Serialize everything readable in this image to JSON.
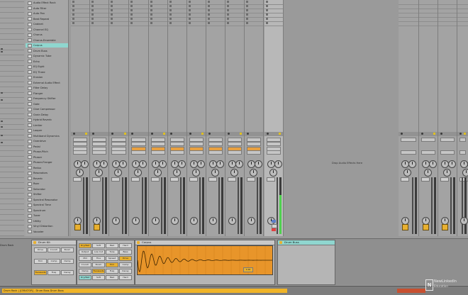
{
  "browser": {
    "items": [
      "Audio Effect Rack",
      "Auto Filter",
      "Auto Pan",
      "Beat Repeat",
      "Cabinet",
      "Channel EQ",
      "Chorus",
      "Chorus-Ensemble",
      "Corpus",
      "Drum Buss",
      "Dynamic Tube",
      "Echo",
      "EQ Eight",
      "EQ Three",
      "Erosion",
      "External Audio Effect",
      "Filter Delay",
      "Flanger",
      "Frequency Shifter",
      "Gate",
      "Glue Compressor",
      "Grain Delay",
      "Hybrid Reverb",
      "Limiter",
      "Looper",
      "Multiband Dynamics",
      "Overdrive",
      "Pedal",
      "Phase-Pitch",
      "Phaser",
      "Phaser-Flanger",
      "Redux",
      "Resonators",
      "Reverb",
      "Roar",
      "Saturator",
      "Shifter",
      "Spectral Resonator",
      "Spectral Time",
      "Spectrum",
      "Tuner",
      "Utility",
      "Vinyl Distortion",
      "Vocoder"
    ],
    "selected_index": 8
  },
  "session": {
    "drop_hint": "Drop Audio Effects Here"
  },
  "devices": {
    "chain_label": "Drum Rack",
    "rack_title": "Drum Kit",
    "corpus_title": "Corpus",
    "corpus_value": "1.00",
    "drum_buss_title": "Drum Buss",
    "buttons": [
      "Drive",
      "Crunch",
      "Boom",
      "Trim",
      "Comp",
      "Damp",
      "Transients",
      "Freq",
      "Decay",
      "Dry/Wet",
      "Soft",
      "Med",
      "Hard",
      "Output",
      "Low Cut",
      "Tune",
      "Bass",
      "Mid",
      "Fine",
      "Spread"
    ]
  },
  "status": {
    "text": "Drum Rack  |  [CREATOR] - Drum Buss  Drum Buss"
  },
  "watermark": {
    "line1": "NewLinkedIn",
    "line2": "Education"
  },
  "colors": {
    "accent": "#e8b030",
    "selection": "#8fd6cf",
    "wave": "#e8952a",
    "meter": "#4fd14f"
  }
}
